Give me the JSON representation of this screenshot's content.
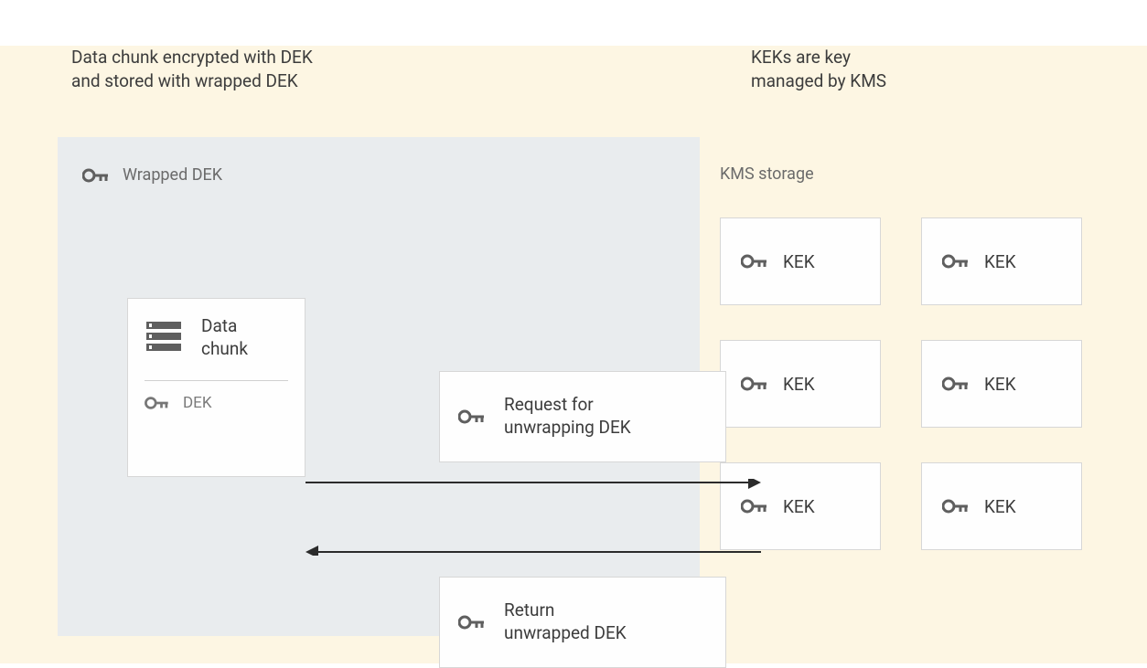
{
  "header": {
    "left_line1": "Data chunk encrypted with DEK",
    "left_line2": "and stored with wrapped DEK",
    "right_line1": "KEKs are key",
    "right_line2": "managed by KMS"
  },
  "left_panel": {
    "title": "Wrapped DEK",
    "data_chunk_label_l1": "Data",
    "data_chunk_label_l2": "chunk",
    "dek_label": "DEK",
    "request_l1": "Request for",
    "request_l2": "unwrapping DEK",
    "return_l1": "Return",
    "return_l2": "unwrapped DEK"
  },
  "right_panel": {
    "title": "KMS storage",
    "kek_label": "KEK"
  }
}
